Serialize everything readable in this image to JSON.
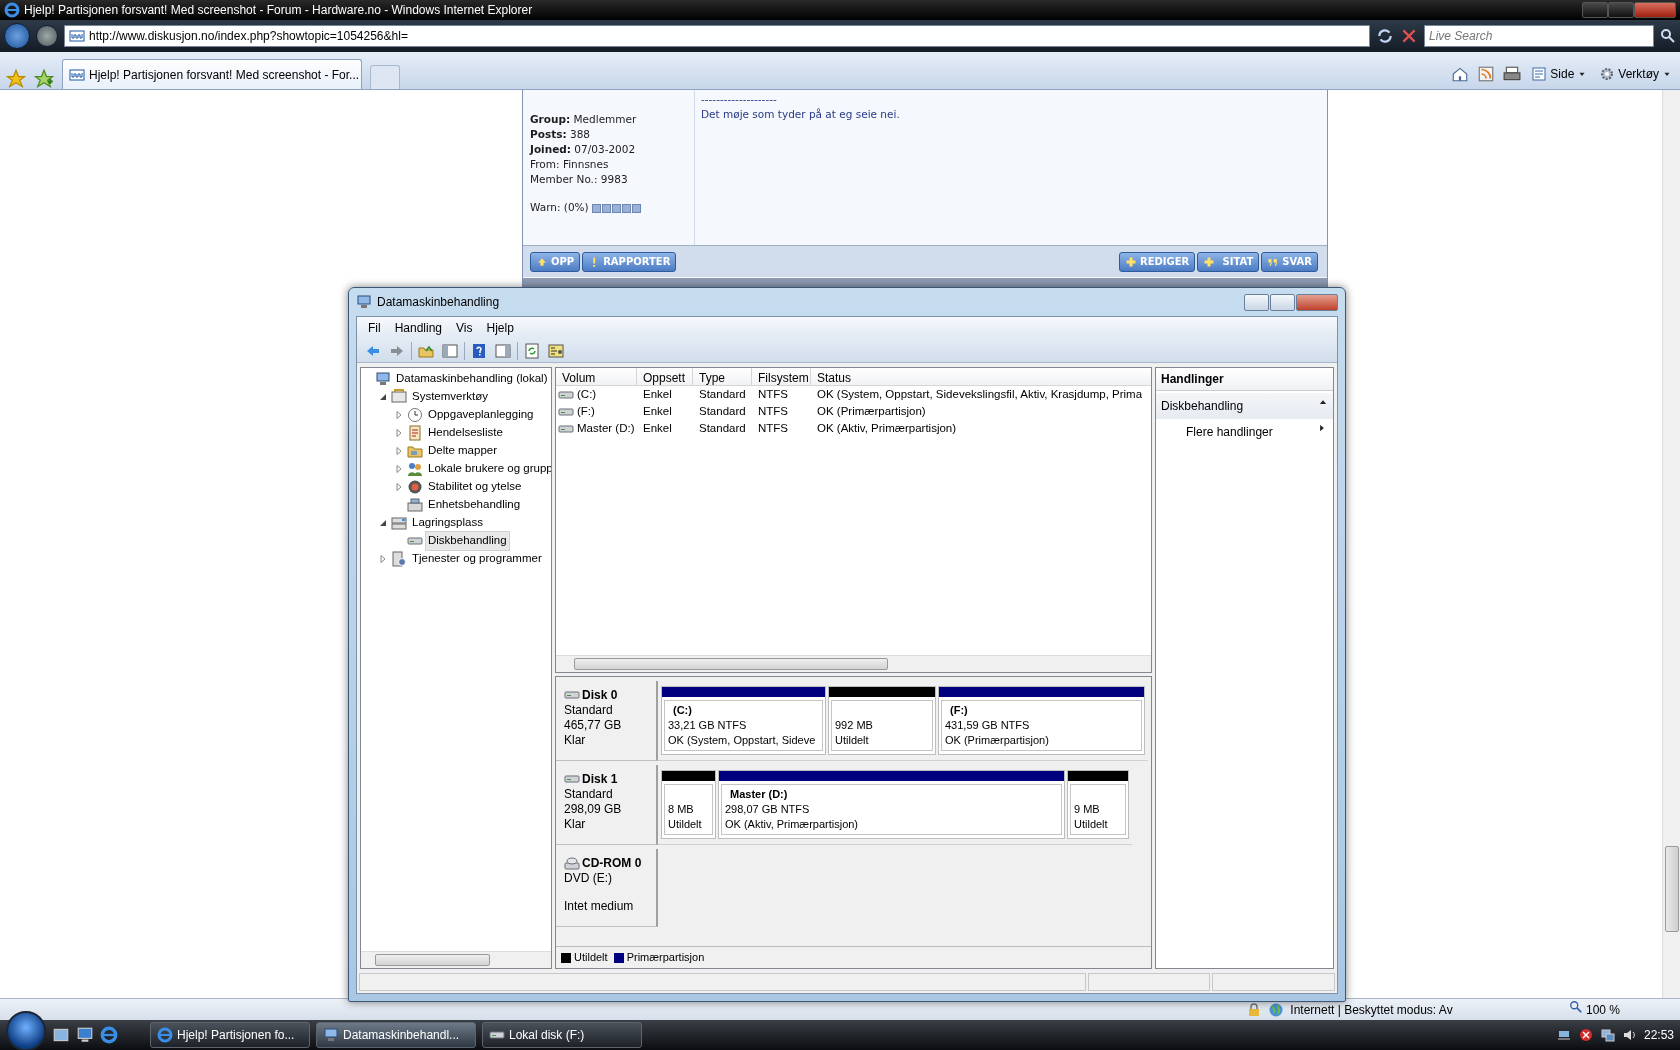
{
  "browser": {
    "title": "Hjelp! Partisjonen forsvant! Med screenshot - Forum - Hardware.no - Windows Internet Explorer",
    "address": "http://www.diskusjon.no/index.php?showtopic=1054256&hl=",
    "search": {
      "placeholder": "Live Search"
    },
    "tabs": [
      {
        "label": "Hjelp! Partisjonen forsvant! Med screenshot - For...",
        "selected": true
      }
    ],
    "toolbar": [
      "Side",
      "Verktøy"
    ],
    "status": {
      "zone": "Internett | Beskyttet modus: Av",
      "zoom": "100 %"
    }
  },
  "forum_post": {
    "profile": [
      "**Group:** Medlemmer",
      "**Posts:** 388",
      "**Joined:** 07/03-2002",
      "From: Finnsnes",
      "Member No.: 9983"
    ],
    "warn": "Warn: (0%)",
    "separator": "--------------------",
    "text": "Det møje som tyder på at eg seie nei.",
    "left_buttons": [
      "OPP",
      "RAPPORTER"
    ],
    "right_buttons": [
      "REDIGER",
      "SITAT",
      "SVAR"
    ]
  },
  "mmc": {
    "title": "Datamaskinbehandling",
    "menu": [
      "Fil",
      "Handling",
      "Vis",
      "Hjelp"
    ],
    "tree": [
      {
        "label": "Datamaskinbehandling (lokal)",
        "selected": false,
        "children": [
          {
            "label": "Systemverktøy",
            "selected": false,
            "expanded": true,
            "children": [
              {
                "label": "Oppgaveplanlegging",
                "selected": false,
                "expanded": false
              },
              {
                "label": "Hendelsesliste",
                "selected": false,
                "expanded": false
              },
              {
                "label": "Delte mapper",
                "selected": false,
                "expanded": false
              },
              {
                "label": "Lokale brukere og grupp",
                "selected": false,
                "expanded": false
              },
              {
                "label": "Stabilitet og ytelse",
                "selected": false,
                "expanded": false
              },
              {
                "label": "Enhetsbehandling",
                "selected": false
              }
            ]
          },
          {
            "label": "Lagringsplass",
            "selected": false,
            "expanded": true,
            "children": [
              {
                "label": "Diskbehandling",
                "selected": true
              }
            ]
          },
          {
            "label": "Tjenester og programmer",
            "selected": false,
            "expanded": false
          }
        ]
      }
    ],
    "volumes": {
      "columns": [
        "Volum",
        "Oppsett",
        "Type",
        "Filsystem",
        "Status"
      ],
      "rows": [
        [
          "(C:)",
          "Enkel",
          "Standard",
          "NTFS",
          "OK (System, Oppstart, Sidevekslingsfil, Aktiv, Krasjdump, Prima"
        ],
        [
          "(F:)",
          "Enkel",
          "Standard",
          "NTFS",
          "OK (Primærpartisjon)"
        ],
        [
          "Master (D:)",
          "Enkel",
          "Standard",
          "NTFS",
          "OK (Aktiv, Primærpartisjon)"
        ]
      ]
    },
    "disks": [
      {
        "kind": "disk",
        "name": "Disk 0",
        "lines": [
          "Standard",
          "465,77 GB",
          "Klar"
        ],
        "partitions": [
          {
            "kind": "primary",
            "label": "(C:)",
            "size": "33,21 GB NTFS",
            "status": "OK (System, Oppstart, Sideve"
          },
          {
            "kind": "unallocated",
            "size": "992 MB",
            "status": "Utildelt"
          },
          {
            "kind": "primary",
            "label": "(F:)",
            "size": "431,59 GB NTFS",
            "status": "OK (Primærpartisjon)"
          }
        ]
      },
      {
        "kind": "disk",
        "name": "Disk 1",
        "lines": [
          "Standard",
          "298,09 GB",
          "Klar"
        ],
        "partitions": [
          {
            "kind": "unallocated",
            "size": "8 MB",
            "status": "Utildelt"
          },
          {
            "kind": "primary",
            "label": "Master  (D:)",
            "size": "298,07 GB NTFS",
            "status": "OK (Aktiv, Primærpartisjon)"
          },
          {
            "kind": "unallocated",
            "size": "9 MB",
            "status": "Utildelt"
          }
        ]
      },
      {
        "kind": "cdrom",
        "name": "CD-ROM 0",
        "lines": [
          "DVD (E:)",
          "Intet medium"
        ]
      }
    ],
    "legend": [
      {
        "label": "Utildelt",
        "color": "#000000"
      },
      {
        "label": "Primærpartisjon",
        "color": "#00007f"
      }
    ],
    "actions": {
      "title": "Handlinger",
      "section": "Diskbehandling",
      "items": [
        "Flere handlinger"
      ]
    }
  },
  "taskbar": {
    "tasks": [
      {
        "label": "Hjelp! Partisjonen fo...",
        "selected": false
      },
      {
        "label": "Datamaskinbehandl...",
        "selected": true
      },
      {
        "label": "Lokal disk (F:)",
        "selected": false
      }
    ],
    "clock": "22:53"
  }
}
